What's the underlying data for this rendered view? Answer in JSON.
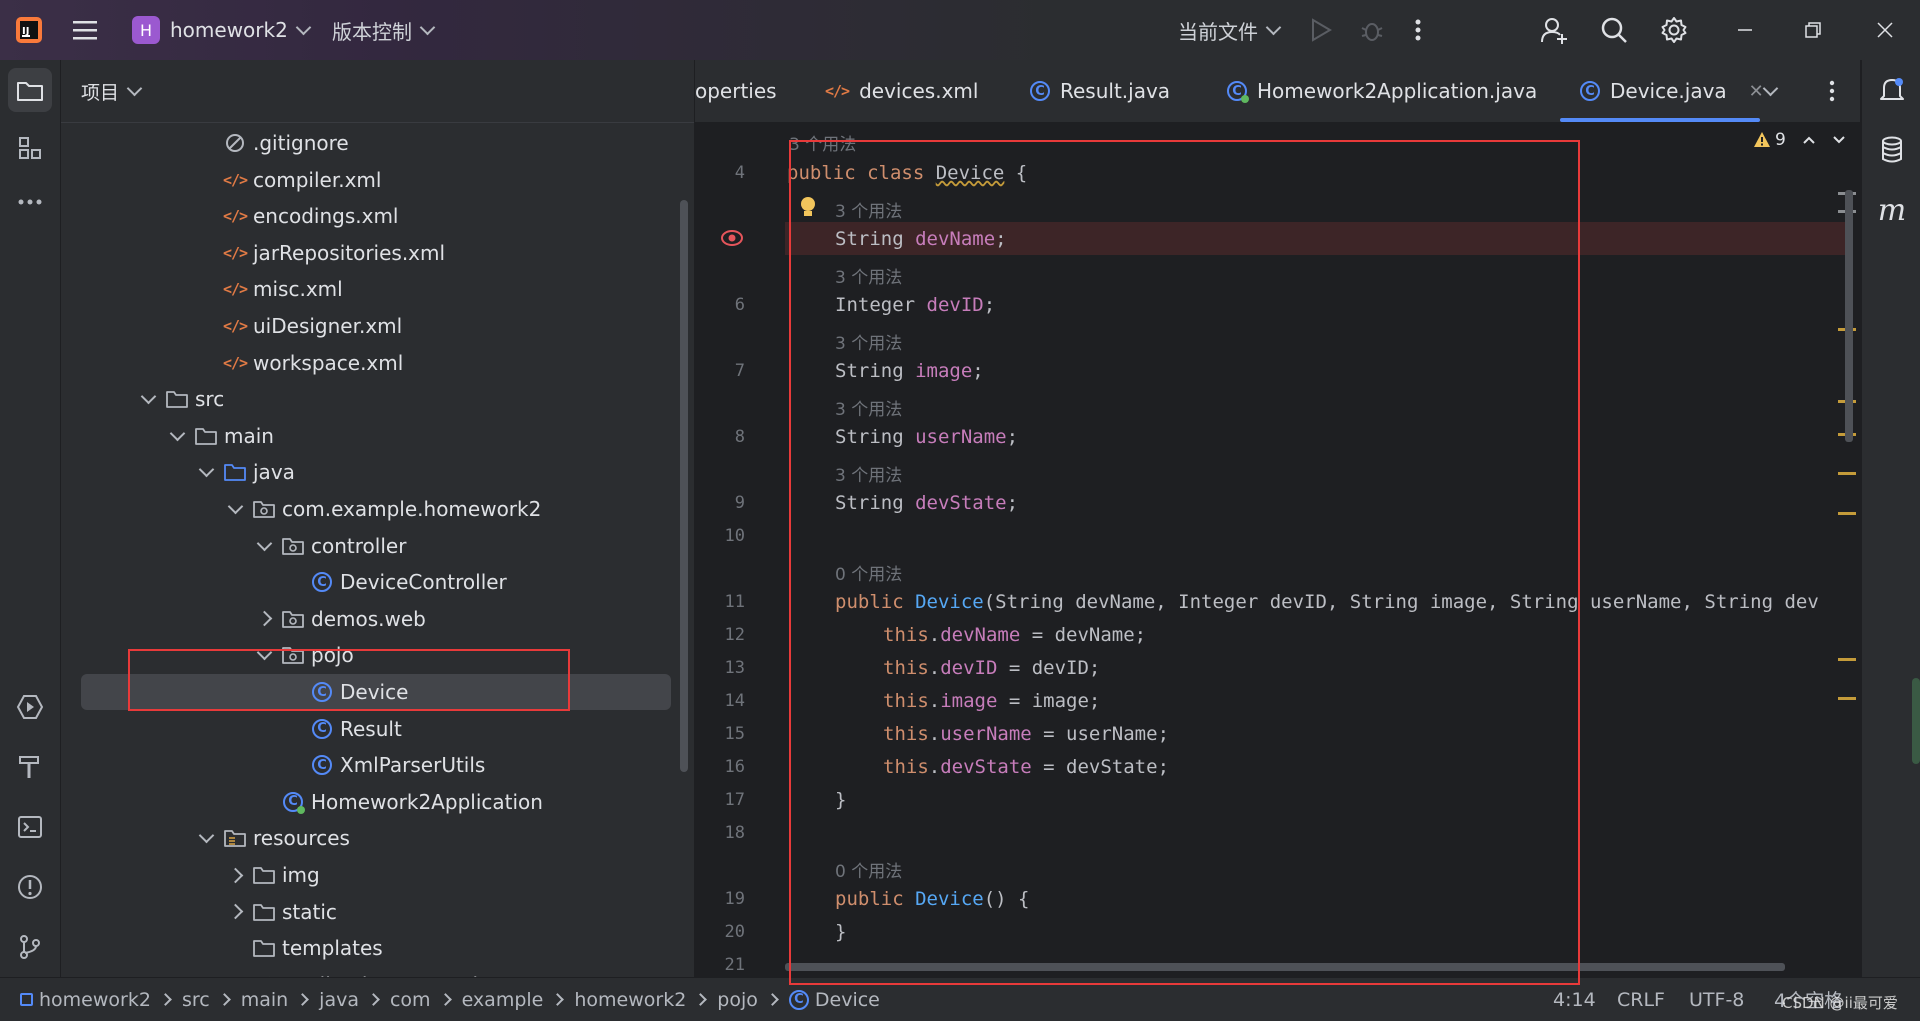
{
  "titlebar": {
    "project_badge": "H",
    "project_name": "homework2",
    "vcs_menu": "版本控制",
    "run_config": "当前文件"
  },
  "project_panel": {
    "title": "项目",
    "items": [
      {
        "label": ".gitignore",
        "icon": "ignore-icon",
        "level": 4
      },
      {
        "label": "compiler.xml",
        "icon": "xml-file-icon",
        "level": 4
      },
      {
        "label": "encodings.xml",
        "icon": "xml-file-icon",
        "level": 4
      },
      {
        "label": "jarRepositories.xml",
        "icon": "xml-file-icon",
        "level": 4
      },
      {
        "label": "misc.xml",
        "icon": "xml-file-icon",
        "level": 4
      },
      {
        "label": "uiDesigner.xml",
        "icon": "xml-file-icon",
        "level": 4
      },
      {
        "label": "workspace.xml",
        "icon": "xml-file-icon",
        "level": 4
      },
      {
        "label": "src",
        "icon": "folder-icon",
        "level": 2,
        "expanded": true
      },
      {
        "label": "main",
        "icon": "folder-icon",
        "level": 3,
        "expanded": true
      },
      {
        "label": "java",
        "icon": "source-folder-icon",
        "level": 4,
        "expanded": true
      },
      {
        "label": "com.example.homework2",
        "icon": "package-icon",
        "level": 5,
        "expanded": true
      },
      {
        "label": "controller",
        "icon": "package-icon",
        "level": 6,
        "expanded": true
      },
      {
        "label": "DeviceController",
        "icon": "class-icon",
        "level": 7
      },
      {
        "label": "demos.web",
        "icon": "package-icon",
        "level": 6,
        "expanded": false
      },
      {
        "label": "pojo",
        "icon": "package-icon",
        "level": 6,
        "expanded": true
      },
      {
        "label": "Device",
        "icon": "class-icon",
        "level": 7,
        "selected": true
      },
      {
        "label": "Result",
        "icon": "class-icon",
        "level": 7
      },
      {
        "label": "XmlParserUtils",
        "icon": "class-icon",
        "level": 7
      },
      {
        "label": "Homework2Application",
        "icon": "spring-class-icon",
        "level": 6
      },
      {
        "label": "resources",
        "icon": "resources-folder-icon",
        "level": 4,
        "expanded": true
      },
      {
        "label": "img",
        "icon": "folder-icon",
        "level": 5,
        "expanded": false
      },
      {
        "label": "static",
        "icon": "folder-icon",
        "level": 5,
        "expanded": false
      },
      {
        "label": "templates",
        "icon": "folder-icon",
        "level": 5
      },
      {
        "label": "application.properties",
        "icon": "properties-icon",
        "level": 5
      }
    ]
  },
  "tabs": [
    {
      "label": "operties",
      "icon": "none"
    },
    {
      "label": "devices.xml",
      "icon": "xml-file-icon"
    },
    {
      "label": "Result.java",
      "icon": "class-icon"
    },
    {
      "label": "Homework2Application.java",
      "icon": "spring-class-icon"
    },
    {
      "label": "Device.java",
      "icon": "class-icon",
      "active": true
    }
  ],
  "editor": {
    "top_hint": "3 个用法",
    "warning_count": "9",
    "lines": [
      {
        "n": "4",
        "kind": "code",
        "html_key": "l4"
      },
      {
        "n": "",
        "kind": "hint",
        "text": "3 个用法"
      },
      {
        "n": "",
        "kind": "code",
        "html_key": "l5"
      },
      {
        "n": "",
        "kind": "hint",
        "text": "3 个用法"
      },
      {
        "n": "6",
        "kind": "code",
        "html_key": "l6"
      },
      {
        "n": "",
        "kind": "hint",
        "text": "3 个用法"
      },
      {
        "n": "7",
        "kind": "code",
        "html_key": "l7"
      },
      {
        "n": "",
        "kind": "hint",
        "text": "3 个用法"
      },
      {
        "n": "8",
        "kind": "code",
        "html_key": "l8"
      },
      {
        "n": "",
        "kind": "hint",
        "text": "3 个用法"
      },
      {
        "n": "9",
        "kind": "code",
        "html_key": "l9"
      },
      {
        "n": "10",
        "kind": "code",
        "html_key": "blank"
      },
      {
        "n": "",
        "kind": "hint",
        "text": "0 个用法"
      },
      {
        "n": "11",
        "kind": "code",
        "html_key": "l11"
      },
      {
        "n": "12",
        "kind": "code",
        "html_key": "l12"
      },
      {
        "n": "13",
        "kind": "code",
        "html_key": "l13"
      },
      {
        "n": "14",
        "kind": "code",
        "html_key": "l14"
      },
      {
        "n": "15",
        "kind": "code",
        "html_key": "l15"
      },
      {
        "n": "16",
        "kind": "code",
        "html_key": "l16"
      },
      {
        "n": "17",
        "kind": "code",
        "html_key": "l17"
      },
      {
        "n": "18",
        "kind": "code",
        "html_key": "blank"
      },
      {
        "n": "",
        "kind": "hint",
        "text": "0 个用法"
      },
      {
        "n": "19",
        "kind": "code",
        "html_key": "l19"
      },
      {
        "n": "20",
        "kind": "code",
        "html_key": "l20"
      },
      {
        "n": "21",
        "kind": "code",
        "html_key": "blank"
      }
    ],
    "code": {
      "l4": [
        [
          "kw",
          "public "
        ],
        [
          "kw",
          "class "
        ],
        [
          "typ",
          "Device"
        ],
        [
          "typ",
          " {"
        ]
      ],
      "l5": [
        [
          "typ",
          "String "
        ],
        [
          "fld",
          "devName"
        ],
        [
          "typ",
          ";"
        ]
      ],
      "l6": [
        [
          "typ",
          "Integer "
        ],
        [
          "fld",
          "devID"
        ],
        [
          "typ",
          ";"
        ]
      ],
      "l7": [
        [
          "typ",
          "String "
        ],
        [
          "fld",
          "image"
        ],
        [
          "typ",
          ";"
        ]
      ],
      "l8": [
        [
          "typ",
          "String "
        ],
        [
          "fld",
          "userName"
        ],
        [
          "typ",
          ";"
        ]
      ],
      "l9": [
        [
          "typ",
          "String "
        ],
        [
          "fld",
          "devState"
        ],
        [
          "typ",
          ";"
        ]
      ],
      "l11": [
        [
          "kw",
          "public "
        ],
        [
          "fn",
          "Device"
        ],
        [
          "typ",
          "(String devName, Integer devID, String image, String userName, String dev"
        ]
      ],
      "l12": [
        [
          "kw",
          "this"
        ],
        [
          "typ",
          "."
        ],
        [
          "fld",
          "devName"
        ],
        [
          "typ",
          " = devName;"
        ]
      ],
      "l13": [
        [
          "kw",
          "this"
        ],
        [
          "typ",
          "."
        ],
        [
          "fld",
          "devID"
        ],
        [
          "typ",
          " = devID;"
        ]
      ],
      "l14": [
        [
          "kw",
          "this"
        ],
        [
          "typ",
          "."
        ],
        [
          "fld",
          "image"
        ],
        [
          "typ",
          " = image;"
        ]
      ],
      "l15": [
        [
          "kw",
          "this"
        ],
        [
          "typ",
          "."
        ],
        [
          "fld",
          "userName"
        ],
        [
          "typ",
          " = userName;"
        ]
      ],
      "l16": [
        [
          "kw",
          "this"
        ],
        [
          "typ",
          "."
        ],
        [
          "fld",
          "devState"
        ],
        [
          "typ",
          " = devState;"
        ]
      ],
      "l17": [
        [
          "typ",
          "}"
        ]
      ],
      "l19": [
        [
          "kw",
          "public "
        ],
        [
          "fn",
          "Device"
        ],
        [
          "typ",
          "() {"
        ]
      ],
      "l20": [
        [
          "typ",
          "}"
        ]
      ],
      "blank": []
    }
  },
  "statusbar": {
    "breadcrumbs": [
      "homework2",
      "src",
      "main",
      "java",
      "com",
      "example",
      "homework2",
      "pojo",
      "Device"
    ],
    "position": "4:14",
    "line_sep": "CRLF",
    "encoding": "UTF-8",
    "indent": "4个空格",
    "watermark": "CSDN @ii最可爱"
  },
  "colors": {
    "accent": "#548af7",
    "annotation_red": "#e83a3a",
    "badge": "#9b59d0"
  }
}
